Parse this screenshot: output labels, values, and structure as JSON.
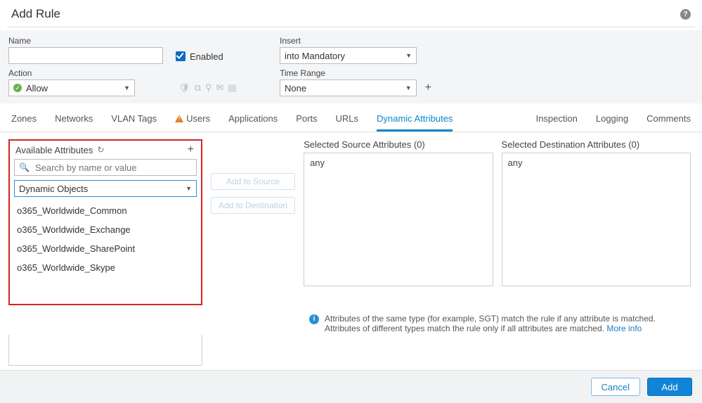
{
  "dialog": {
    "title": "Add Rule"
  },
  "form": {
    "name": {
      "label": "Name",
      "value": ""
    },
    "enabled": {
      "label": "Enabled",
      "checked": true
    },
    "insert": {
      "label": "Insert",
      "value": "into Mandatory"
    },
    "action": {
      "label": "Action",
      "value": "Allow"
    },
    "time_range": {
      "label": "Time Range",
      "value": "None"
    }
  },
  "tabs": {
    "left": [
      "Zones",
      "Networks",
      "VLAN Tags",
      "Users",
      "Applications",
      "Ports",
      "URLs",
      "Dynamic Attributes"
    ],
    "right": [
      "Inspection",
      "Logging",
      "Comments"
    ],
    "active": "Dynamic Attributes",
    "users_warning": true
  },
  "available": {
    "title": "Available Attributes",
    "search_placeholder": "Search by name or value",
    "type_select": "Dynamic Objects",
    "items": [
      "o365_Worldwide_Common",
      "o365_Worldwide_Exchange",
      "o365_Worldwide_SharePoint",
      "o365_Worldwide_Skype"
    ]
  },
  "buttons": {
    "add_to_source": "Add to Source",
    "add_to_destination": "Add to Destination",
    "cancel": "Cancel",
    "add": "Add"
  },
  "selected_source": {
    "title": "Selected Source Attributes (0)",
    "value": "any"
  },
  "selected_destination": {
    "title": "Selected Destination Attributes (0)",
    "value": "any"
  },
  "info": {
    "text": "Attributes of the same type (for example, SGT) match the rule if any attribute is matched. Attributes of different types match the rule only if all attributes are matched. ",
    "more": "More info"
  },
  "icons": {
    "help": "help-icon",
    "refresh": "refresh-icon",
    "plus": "plus-icon",
    "search": "search-icon",
    "caret": "chevron-down-icon",
    "allow": "allow-circle-icon",
    "shield": "shield-icon",
    "tag": "tag-icon",
    "user": "user-icon",
    "mail": "mail-icon",
    "clipboard": "clipboard-icon",
    "info": "info-icon",
    "warn": "warning-icon"
  }
}
